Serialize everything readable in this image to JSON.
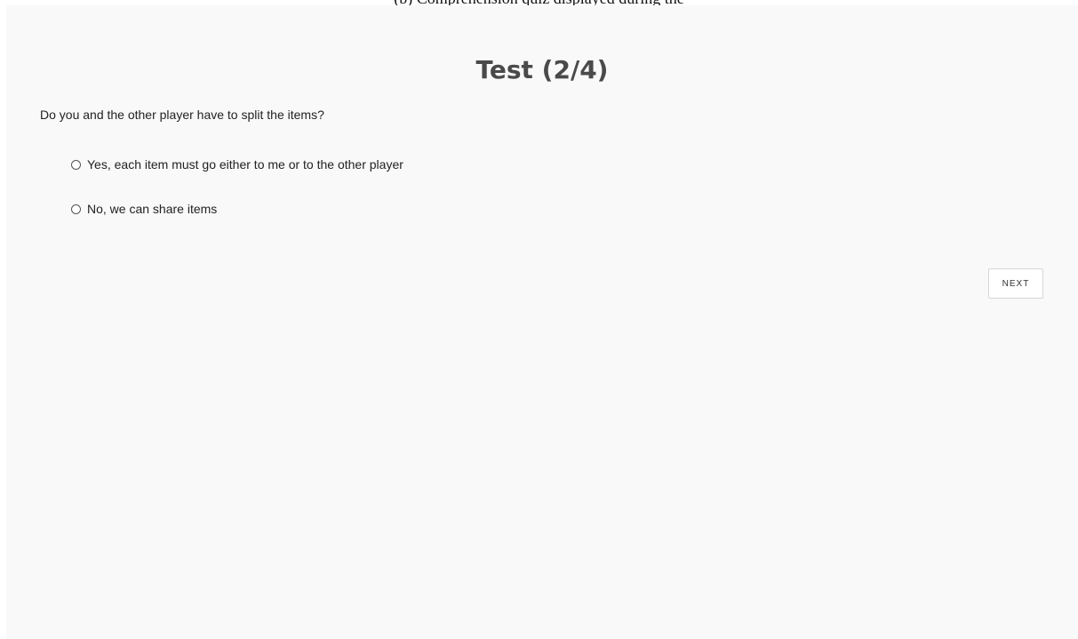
{
  "top_caption": "(b) Comprehension quiz displayed during the",
  "page": {
    "title": "Test (2/4)",
    "question": "Do you and the other player have to split the items?",
    "options": [
      {
        "label": "Yes, each item must go either to me or to the other player",
        "selected": false
      },
      {
        "label": "No, we can share items",
        "selected": false
      }
    ],
    "next_label": "NEXT"
  }
}
